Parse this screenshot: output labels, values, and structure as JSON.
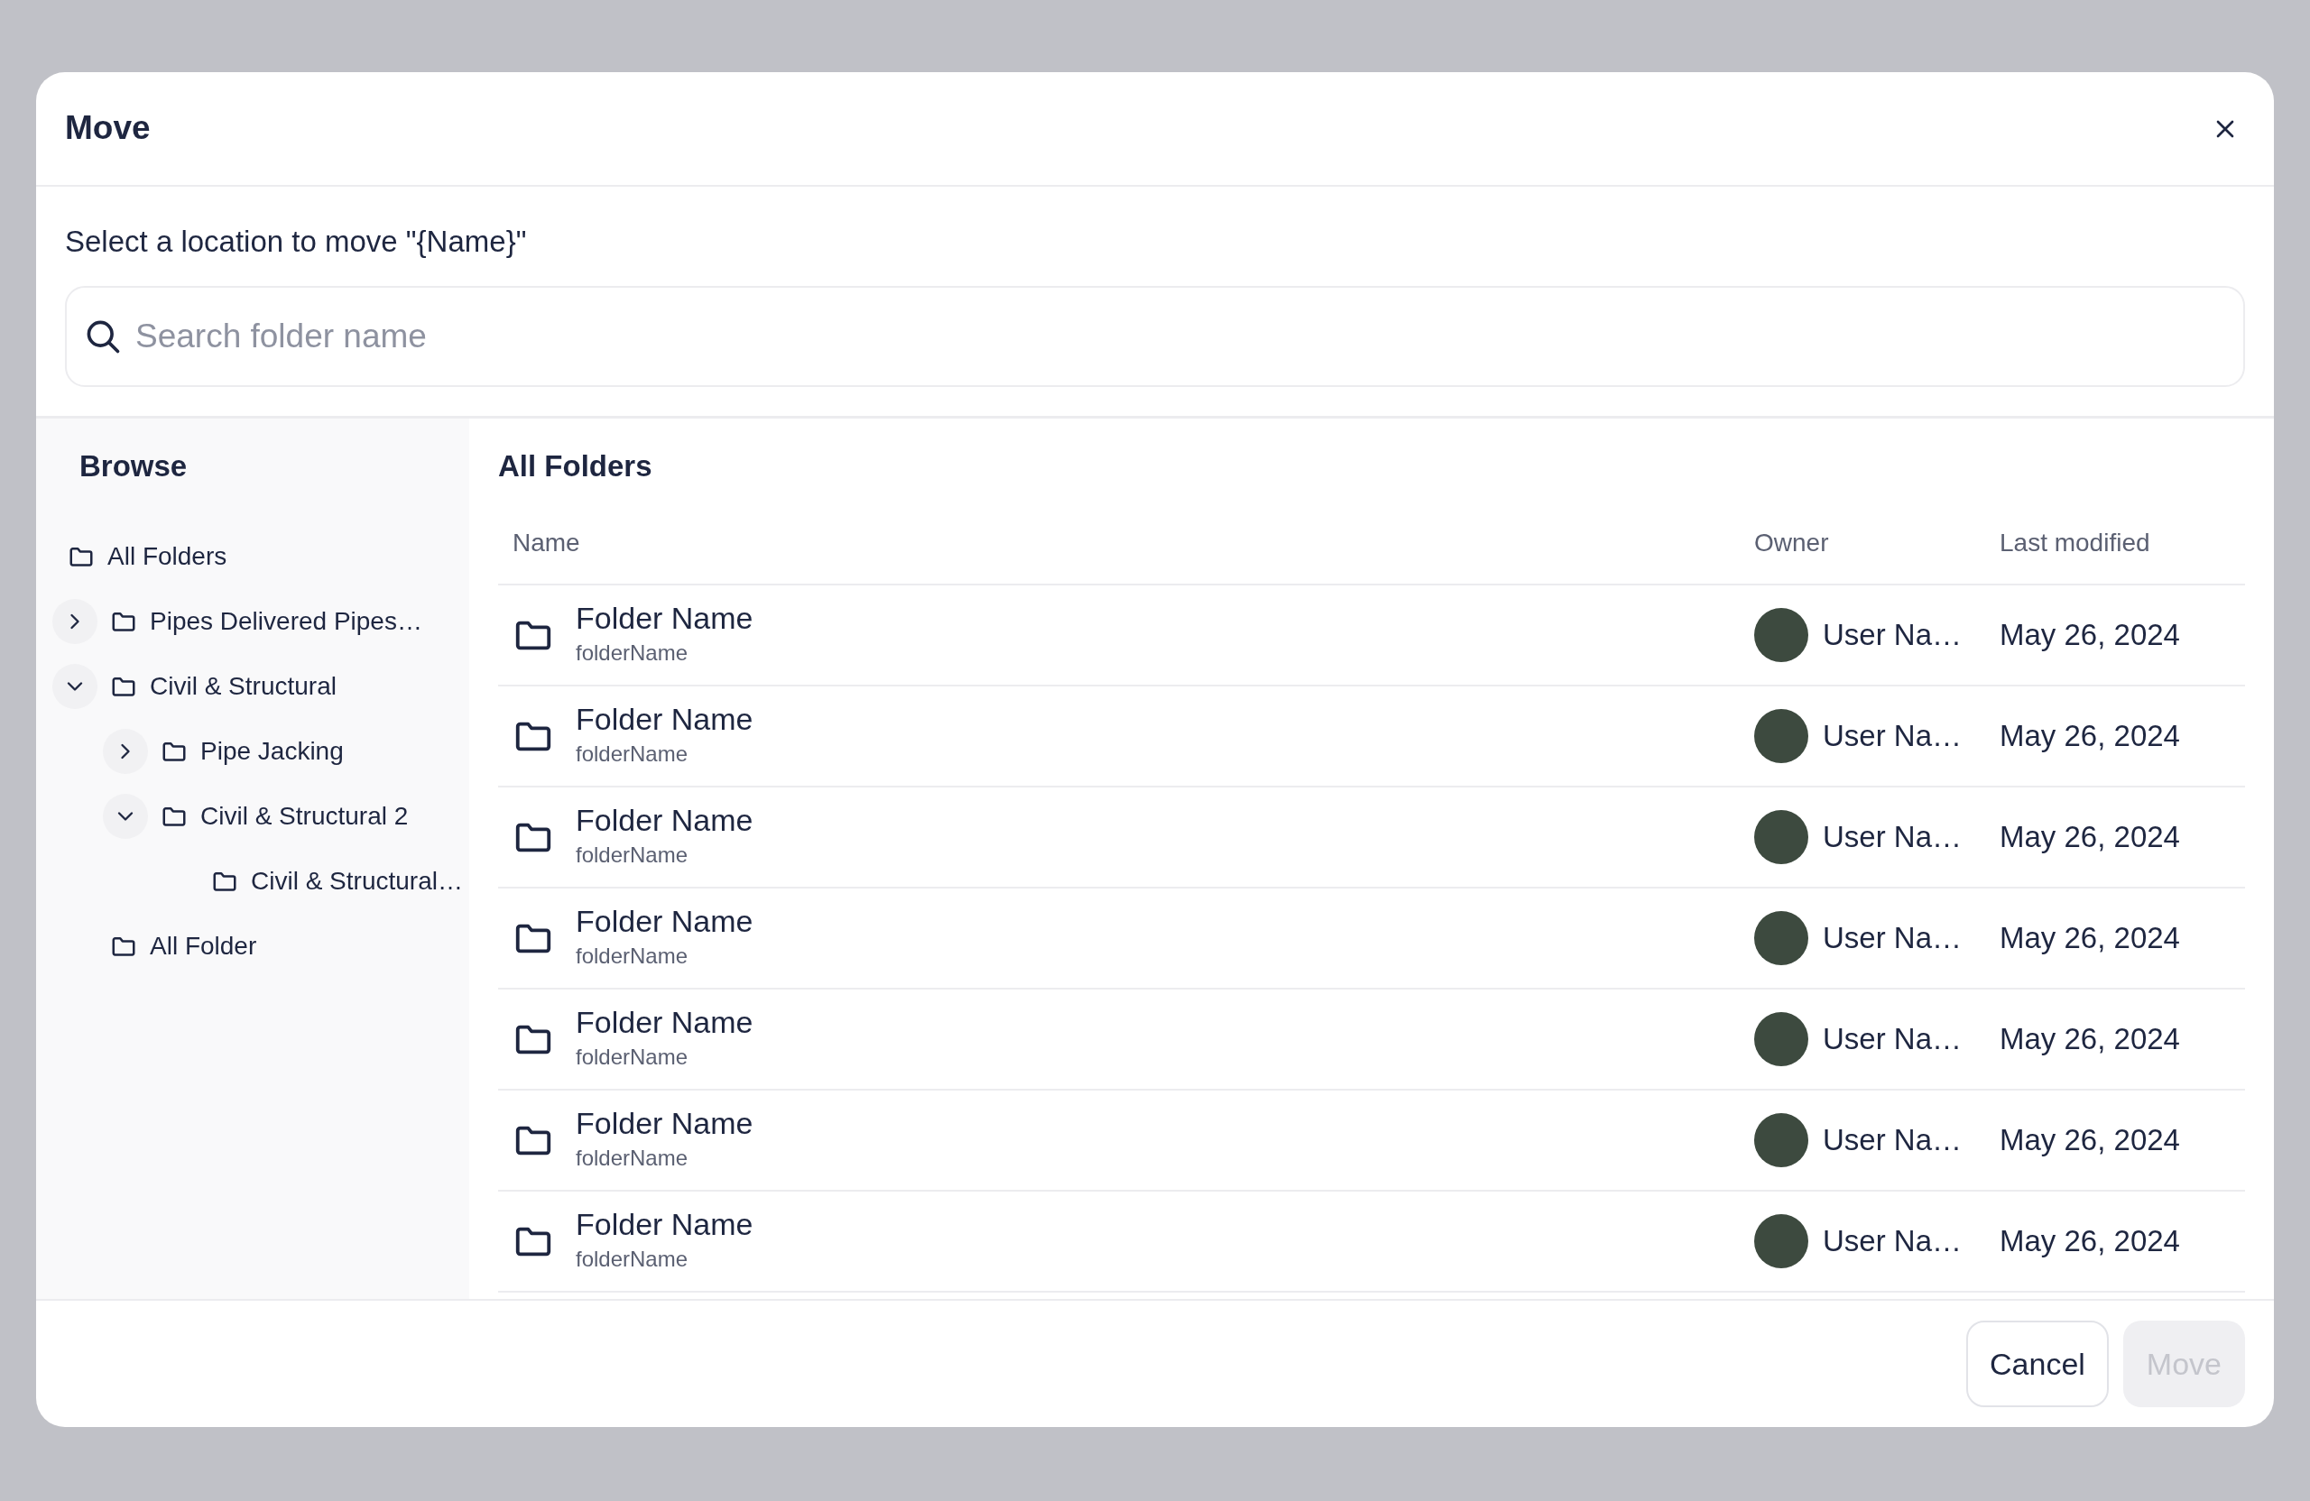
{
  "dialog": {
    "title": "Move",
    "prompt": "Select a location to move \"{Name}\"",
    "search": {
      "placeholder": "Search folder name"
    }
  },
  "sidebar": {
    "title": "Browse",
    "tree": [
      {
        "label": "All Folders",
        "children": [
          {
            "label": "Pipes Delivered Pipes…",
            "expanded": false
          },
          {
            "label": "Civil & Structural",
            "expanded": true,
            "children": [
              {
                "label": "Pipe Jacking",
                "expanded": false
              },
              {
                "label": "Civil & Structural 2",
                "expanded": true,
                "children": [
                  {
                    "label": "Civil & Structural…"
                  }
                ]
              }
            ]
          },
          {
            "label": "All Folder"
          }
        ]
      }
    ]
  },
  "content": {
    "title": "All Folders",
    "table": {
      "columns": [
        "Name",
        "Owner",
        "Last modified"
      ],
      "rows": [
        {
          "name": "Folder Name",
          "subname": "folderName",
          "owner": "User Na…",
          "modified": "May 26, 2024"
        },
        {
          "name": "Folder Name",
          "subname": "folderName",
          "owner": "User Na…",
          "modified": "May 26, 2024"
        },
        {
          "name": "Folder Name",
          "subname": "folderName",
          "owner": "User Na…",
          "modified": "May 26, 2024"
        },
        {
          "name": "Folder Name",
          "subname": "folderName",
          "owner": "User Na…",
          "modified": "May 26, 2024"
        },
        {
          "name": "Folder Name",
          "subname": "folderName",
          "owner": "User Na…",
          "modified": "May 26, 2024"
        },
        {
          "name": "Folder Name",
          "subname": "folderName",
          "owner": "User Na…",
          "modified": "May 26, 2024"
        },
        {
          "name": "Folder Name",
          "subname": "folderName",
          "owner": "User Na…",
          "modified": "May 26, 2024"
        }
      ]
    }
  },
  "buttons": [
    {
      "label": "Cancel",
      "disabled": false
    },
    {
      "label": "Move",
      "disabled": true
    }
  ]
}
